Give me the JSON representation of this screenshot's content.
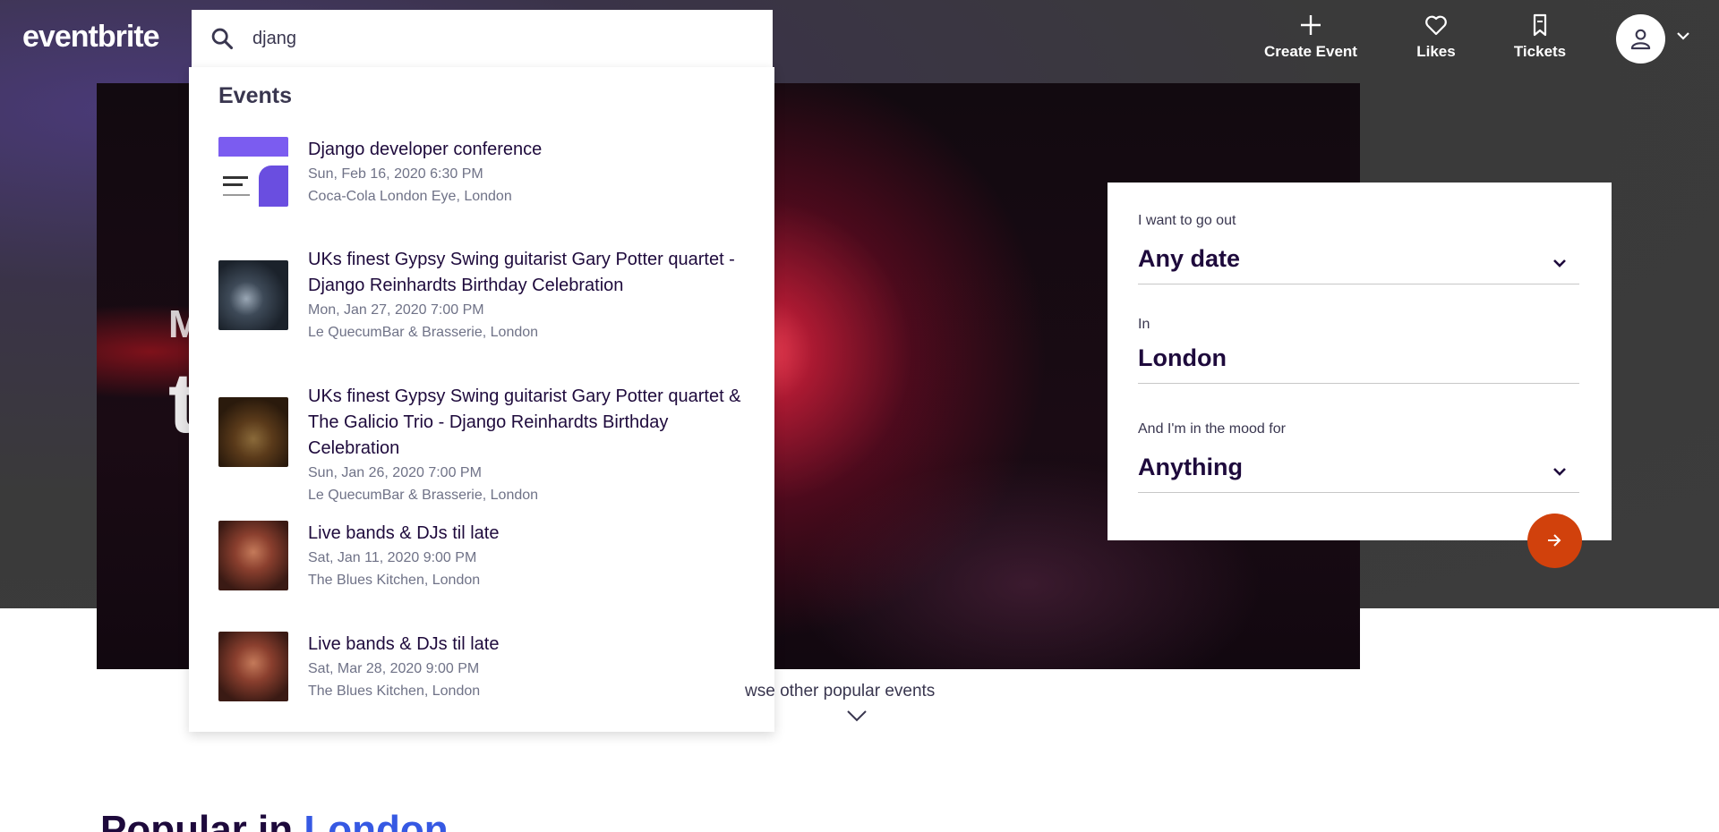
{
  "brand": {
    "logo": "eventbrite"
  },
  "search": {
    "value": "djang",
    "placeholder": ""
  },
  "nav": {
    "create_event": "Create Event",
    "likes": "Likes",
    "tickets": "Tickets"
  },
  "hero": {
    "headline_small": "M",
    "headline_large": "t"
  },
  "dropdown": {
    "section_title": "Events",
    "results": [
      {
        "title": "Django developer conference",
        "date": "Sun, Feb 16, 2020 6:30 PM",
        "venue": "Coca-Cola London Eye, London"
      },
      {
        "title": "UKs finest Gypsy Swing guitarist Gary Potter quartet - Django Reinhardts Birthday Celebration",
        "date": "Mon, Jan 27, 2020 7:00 PM",
        "venue": "Le QuecumBar & Brasserie, London"
      },
      {
        "title": "UKs finest Gypsy Swing guitarist Gary Potter quartet & The Galicio Trio - Django Reinhardts Birthday Celebration",
        "date": "Sun, Jan 26, 2020 7:00 PM",
        "venue": "Le QuecumBar & Brasserie, London"
      },
      {
        "title": "Live bands & DJs til late",
        "date": "Sat, Jan 11, 2020 9:00 PM",
        "venue": "The Blues Kitchen, London"
      },
      {
        "title": "Live bands & DJs til late",
        "date": "Sat, Mar 28, 2020 9:00 PM",
        "venue": "The Blues Kitchen, London"
      }
    ]
  },
  "filter": {
    "date_label": "I want to go out",
    "date_value": "Any date",
    "location_label": "In",
    "location_value": "London",
    "mood_label": "And I'm in the mood for",
    "mood_value": "Anything"
  },
  "browse": {
    "text": "wse other popular events"
  },
  "popular": {
    "prefix": "Popular in ",
    "city": "London"
  },
  "colors": {
    "accent": "#d1410c",
    "link_blue": "#3659e3",
    "text_dark": "#1e0a3c"
  }
}
